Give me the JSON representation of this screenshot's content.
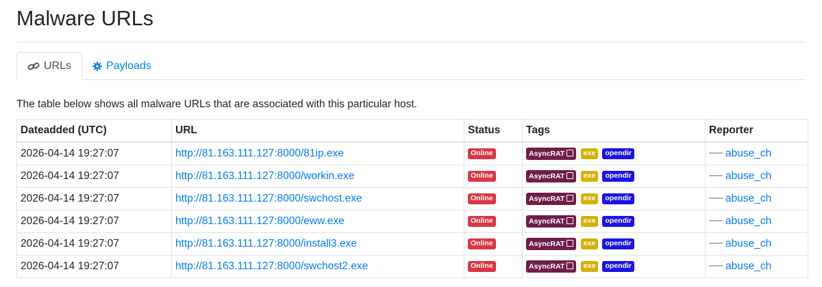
{
  "page": {
    "title": "Malware URLs"
  },
  "tabs": [
    {
      "label": "URLs",
      "icon": "link-icon",
      "active": true
    },
    {
      "label": "Payloads",
      "icon": "gear-icon",
      "active": false
    }
  ],
  "intro": "The table below shows all malware URLs that are associated with this particular host.",
  "table": {
    "headers": [
      "Dateadded (UTC)",
      "URL",
      "Status",
      "Tags",
      "Reporter"
    ],
    "rows": [
      {
        "date": "2026-04-14 19:27:07",
        "url": "http://81.163.111.127:8000/81ip.exe",
        "status": "Online",
        "tags": [
          "AsyncRAT",
          "exe",
          "opendir"
        ],
        "reporter": "abuse_ch"
      },
      {
        "date": "2026-04-14 19:27:07",
        "url": "http://81.163.111.127:8000/workin.exe",
        "status": "Online",
        "tags": [
          "AsyncRAT",
          "exe",
          "opendir"
        ],
        "reporter": "abuse_ch"
      },
      {
        "date": "2026-04-14 19:27:07",
        "url": "http://81.163.111.127:8000/swchost.exe",
        "status": "Online",
        "tags": [
          "AsyncRAT",
          "exe",
          "opendir"
        ],
        "reporter": "abuse_ch"
      },
      {
        "date": "2026-04-14 19:27:07",
        "url": "http://81.163.111.127:8000/eww.exe",
        "status": "Online",
        "tags": [
          "AsyncRAT",
          "exe",
          "opendir"
        ],
        "reporter": "abuse_ch"
      },
      {
        "date": "2026-04-14 19:27:07",
        "url": "http://81.163.111.127:8000/install3.exe",
        "status": "Online",
        "tags": [
          "AsyncRAT",
          "exe",
          "opendir"
        ],
        "reporter": "abuse_ch"
      },
      {
        "date": "2026-04-14 19:27:07",
        "url": "http://81.163.111.127:8000/swchost2.exe",
        "status": "Online",
        "tags": [
          "AsyncRAT",
          "exe",
          "opendir"
        ],
        "reporter": "abuse_ch"
      }
    ]
  },
  "colors": {
    "link": "#007bff",
    "online": "#dc3545",
    "asyncrat": "#6f1d4b",
    "exe": "#d4b106",
    "opendir": "#1a12e6"
  }
}
